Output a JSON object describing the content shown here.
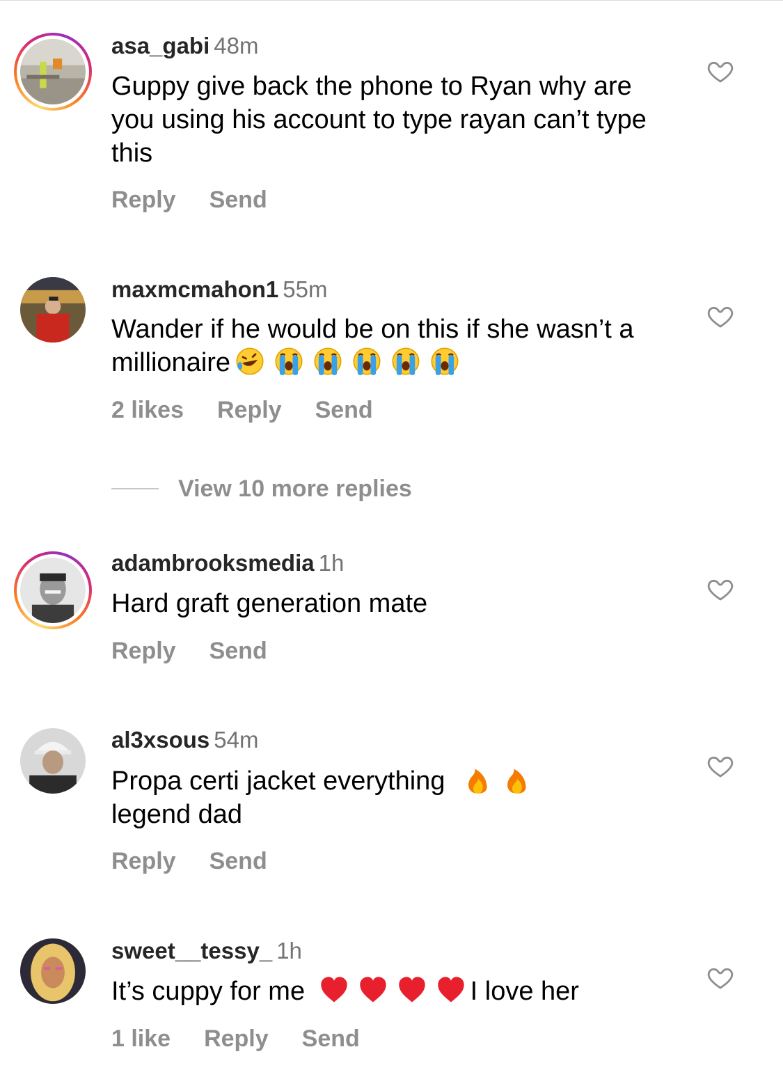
{
  "comments": [
    {
      "username": "asa_gabi",
      "time": "48m",
      "text": "Guppy give back the phone to Ryan why are you using his account to type rayan can’t type this",
      "likes": "",
      "reply": "Reply",
      "send": "Send"
    },
    {
      "username": "maxmcmahon1",
      "time": "55m",
      "text": "Wander if he would be on this if she wasn’t a millionaire",
      "emojis": [
        "rofl-emoji",
        "crying-emoji",
        "crying-emoji",
        "crying-emoji",
        "crying-emoji",
        "crying-emoji"
      ],
      "likes": "2 likes",
      "reply": "Reply",
      "send": "Send"
    },
    {
      "username": "adambrooksmedia",
      "time": "1h",
      "text": "Hard graft generation mate",
      "likes": "",
      "reply": "Reply",
      "send": "Send"
    },
    {
      "username": "al3xsous",
      "time": "54m",
      "text_before": "Propa certi jacket everything",
      "text_after": "legend dad",
      "emojis": [
        "fire-emoji",
        "fire-emoji"
      ],
      "likes": "",
      "reply": "Reply",
      "send": "Send"
    },
    {
      "username": "sweet__tessy_",
      "time": "1h",
      "text_before": "It’s cuppy for me",
      "text_after": "I love her",
      "emojis": [
        "red-heart-emoji",
        "red-heart-emoji",
        "red-heart-emoji",
        "red-heart-emoji"
      ],
      "likes": "1 like",
      "reply": "Reply",
      "send": "Send"
    }
  ],
  "view_more": "View 10 more replies",
  "icons": {
    "like": "heart-outline-icon"
  },
  "colors": {
    "meta": "#8e8e8e",
    "username": "#262626",
    "story_ring": "#d62976"
  }
}
